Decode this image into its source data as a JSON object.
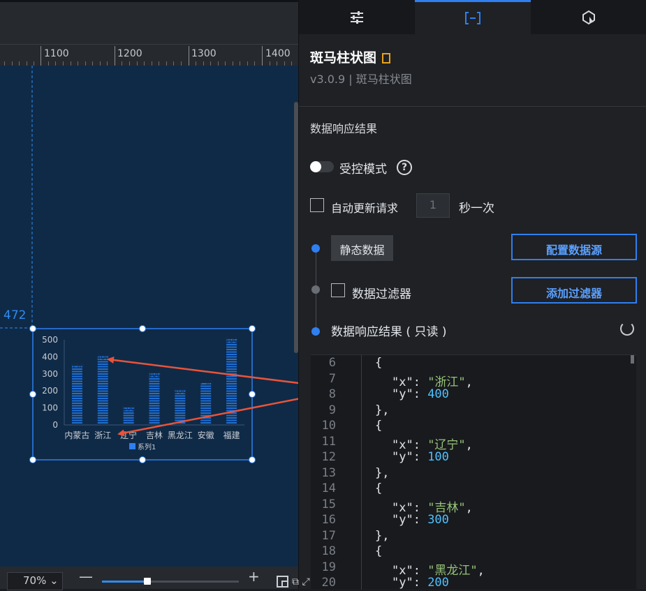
{
  "ruler": {
    "ticks": [
      "1100",
      "1200",
      "1300",
      "1400"
    ]
  },
  "guide": {
    "value": "472"
  },
  "chart_data": {
    "type": "bar",
    "categories": [
      "内蒙古",
      "浙江",
      "辽宁",
      "吉林",
      "黑龙江",
      "安徽",
      "福建"
    ],
    "series": [
      {
        "name": "系列1",
        "values": [
          350,
          400,
          100,
          300,
          200,
          250,
          500
        ]
      }
    ],
    "yticks": [
      "500",
      "400",
      "300",
      "200",
      "100",
      "0"
    ],
    "ylim": [
      0,
      500
    ]
  },
  "zoom": {
    "value": "70",
    "unit": "%",
    "slider_fraction": 0.35
  },
  "tabs": [
    {
      "icon": "sliders-icon"
    },
    {
      "icon": "data-bracket-icon"
    },
    {
      "icon": "interaction-icon"
    }
  ],
  "component": {
    "title": "斑马柱状图",
    "version": "v3.0.9 | 斑马柱状图"
  },
  "section": {
    "title": "数据响应结果"
  },
  "controlled": {
    "label": "受控模式",
    "help": "?"
  },
  "auto_update": {
    "label": "自动更新请求",
    "interval_placeholder": "1",
    "unit": "秒一次"
  },
  "static": {
    "label": "静态数据",
    "config_button": "配置数据源"
  },
  "filter": {
    "label": "数据过滤器",
    "add_button": "添加过滤器"
  },
  "result": {
    "label": "数据响应结果 ( 只读 )"
  },
  "code_lines": [
    {
      "n": "6",
      "text": "{"
    },
    {
      "n": "7",
      "key": "\"x\"",
      "val": "\"浙江\"",
      "type": "str",
      "comma": true
    },
    {
      "n": "8",
      "key": "\"y\"",
      "val": "400",
      "type": "num"
    },
    {
      "n": "9",
      "text": "},"
    },
    {
      "n": "10",
      "text": "{"
    },
    {
      "n": "11",
      "key": "\"x\"",
      "val": "\"辽宁\"",
      "type": "str",
      "comma": true
    },
    {
      "n": "12",
      "key": "\"y\"",
      "val": "100",
      "type": "num"
    },
    {
      "n": "13",
      "text": "},"
    },
    {
      "n": "14",
      "text": "{"
    },
    {
      "n": "15",
      "key": "\"x\"",
      "val": "\"吉林\"",
      "type": "str",
      "comma": true
    },
    {
      "n": "16",
      "key": "\"y\"",
      "val": "300",
      "type": "num"
    },
    {
      "n": "17",
      "text": "},"
    },
    {
      "n": "18",
      "text": "{"
    },
    {
      "n": "19",
      "key": "\"x\"",
      "val": "\"黑龙江\"",
      "type": "str",
      "comma": true
    },
    {
      "n": "20",
      "key": "\"y\"",
      "val": "200",
      "type": "num"
    }
  ],
  "colors": {
    "accent": "#2f7ff0",
    "arrow": "#e8543a",
    "bar": "#1f6fd6"
  }
}
